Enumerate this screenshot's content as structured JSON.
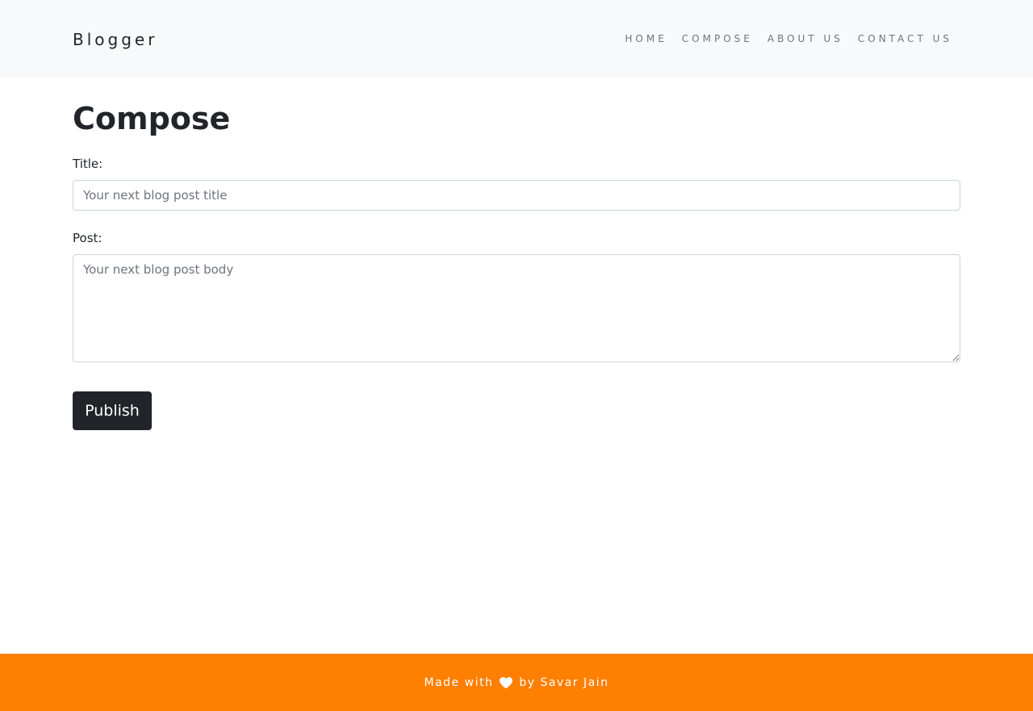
{
  "navbar": {
    "brand": "Blogger",
    "items": [
      {
        "label": "HOME"
      },
      {
        "label": "COMPOSE"
      },
      {
        "label": "ABOUT US"
      },
      {
        "label": "CONTACT US"
      }
    ]
  },
  "main": {
    "heading": "Compose",
    "title_label": "Title:",
    "title_placeholder": "Your next blog post title",
    "title_value": "",
    "post_label": "Post:",
    "post_placeholder": "Your next blog post body",
    "post_value": "",
    "publish_label": "Publish"
  },
  "footer": {
    "text_before": "Made with",
    "icon": "heart-icon",
    "text_after": "by Savar Jain"
  },
  "colors": {
    "navbar_bg": "#f8f9fa",
    "footer_bg": "#ff7f00",
    "button_bg": "#212529"
  }
}
